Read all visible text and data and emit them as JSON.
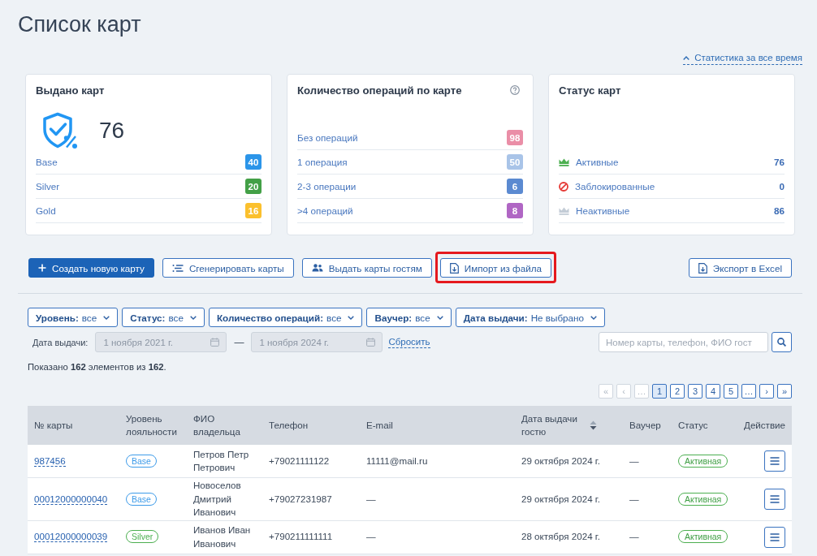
{
  "page": {
    "title": "Список карт",
    "stats_link": {
      "label": "Статистика за все время",
      "expanded": true
    }
  },
  "stat_cards": [
    {
      "kind": "issued",
      "title": "Выдано карт",
      "help": false,
      "total": "76",
      "rows": [
        {
          "label": "Base",
          "count": "40",
          "color": "#2b95e9"
        },
        {
          "label": "Silver",
          "count": "20",
          "color": "#43a047"
        },
        {
          "label": "Gold",
          "count": "16",
          "color": "#fbc02d"
        }
      ]
    },
    {
      "kind": "operations",
      "title": "Количество операций по карте",
      "help": true,
      "rows": [
        {
          "label": "Без операций",
          "count": "98",
          "color": "#ea8ea7"
        },
        {
          "label": "1 операция",
          "count": "50",
          "color": "#a9c4e8"
        },
        {
          "label": "2-3 операции",
          "count": "6",
          "color": "#5b8ad1"
        },
        {
          "label": ">4 операций",
          "count": "8",
          "color": "#b066c4"
        }
      ]
    },
    {
      "kind": "status",
      "title": "Статус карт",
      "help": false,
      "rows": [
        {
          "kind": "active",
          "label": "Активные",
          "count": "76"
        },
        {
          "kind": "blocked",
          "label": "Заблокированные",
          "count": "0"
        },
        {
          "kind": "inactive",
          "label": "Неактивные",
          "count": "86"
        }
      ]
    }
  ],
  "actions": [
    {
      "kind": "create",
      "label": "Создать новую карту",
      "primary": true,
      "highlighted": false
    },
    {
      "kind": "generate",
      "label": "Сгенерировать карты",
      "primary": false,
      "highlighted": false
    },
    {
      "kind": "guests",
      "label": "Выдать карты гостям",
      "primary": false,
      "highlighted": false
    },
    {
      "kind": "import",
      "label": "Импорт из файла",
      "primary": false,
      "highlighted": true
    }
  ],
  "export_button": {
    "kind": "export",
    "label": "Экспорт в Excel"
  },
  "filters": {
    "dropdowns": [
      {
        "label": "Уровень:",
        "value": "все"
      },
      {
        "label": "Статус:",
        "value": "все"
      },
      {
        "label": "Количество операций:",
        "value": "все"
      },
      {
        "label": "Ваучер:",
        "value": "все"
      },
      {
        "label": "Дата выдачи:",
        "value": "Не выбрано"
      }
    ],
    "date_range": {
      "label": "Дата выдачи:",
      "from": "1 ноября 2021 г.",
      "separator": "—",
      "to": "1 ноября 2024 г.",
      "disabled": true,
      "reset": "Сбросить"
    },
    "search": {
      "placeholder": "Номер карты, телефон, ФИО гост"
    }
  },
  "summary": "Показано **162** элементов из **162**.",
  "pagination": [
    {
      "label": "«",
      "selected": false,
      "disabled": true
    },
    {
      "label": "‹",
      "selected": false,
      "disabled": true
    },
    {
      "label": "…",
      "selected": false,
      "disabled": true
    },
    {
      "label": "1",
      "selected": true,
      "disabled": false
    },
    {
      "label": "2",
      "selected": false,
      "disabled": false
    },
    {
      "label": "3",
      "selected": false,
      "disabled": false
    },
    {
      "label": "4",
      "selected": false,
      "disabled": false
    },
    {
      "label": "5",
      "selected": false,
      "disabled": false
    },
    {
      "label": "…",
      "selected": false,
      "disabled": false
    },
    {
      "label": "›",
      "selected": false,
      "disabled": false
    },
    {
      "label": "»",
      "selected": false,
      "disabled": false
    }
  ],
  "table": {
    "columns": [
      {
        "label": "№ карты",
        "sortable": false
      },
      {
        "label": "Уровень лояльности",
        "sortable": false
      },
      {
        "label": "ФИО владельца",
        "sortable": false
      },
      {
        "label": "Телефон",
        "sortable": false
      },
      {
        "label": "E-mail",
        "sortable": false
      },
      {
        "label": "Дата выдачи гостю",
        "sortable": true
      },
      {
        "label": "Ваучер",
        "sortable": false
      },
      {
        "label": "Статус",
        "sortable": false
      },
      {
        "label": "Действие",
        "sortable": false
      }
    ],
    "rows": [
      {
        "card_number": "987456",
        "level": {
          "label": "Base",
          "color": "#3d9be9"
        },
        "owner": "Петров Петр Петрович",
        "phone": "+79021111122",
        "email": "11111@mail.ru",
        "issue_date": "29 октября 2024 г.",
        "voucher": "—",
        "status": "Активная"
      },
      {
        "card_number": "00012000000040",
        "level": {
          "label": "Base",
          "color": "#3d9be9"
        },
        "owner": "Новоселов Дмитрий Иванович",
        "phone": "+79027231987",
        "email": "—",
        "issue_date": "29 октября 2024 г.",
        "voucher": "—",
        "status": "Активная"
      },
      {
        "card_number": "00012000000039",
        "level": {
          "label": "Silver",
          "color": "#4caf50"
        },
        "owner": "Иванов Иван Иванович",
        "phone": "+790211111111",
        "email": "—",
        "issue_date": "28 октября 2024 г.",
        "voucher": "—",
        "status": "Активная"
      }
    ]
  }
}
